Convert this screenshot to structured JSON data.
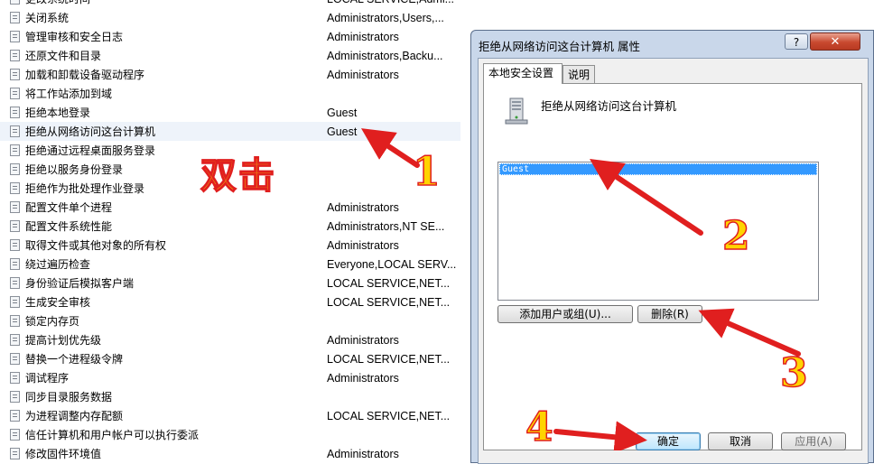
{
  "policies": [
    {
      "name": "更改系统时间",
      "value": "LOCAL SERVICE,Admi..."
    },
    {
      "name": "关闭系统",
      "value": "Administrators,Users,..."
    },
    {
      "name": "管理审核和安全日志",
      "value": "Administrators"
    },
    {
      "name": "还原文件和目录",
      "value": "Administrators,Backu..."
    },
    {
      "name": "加载和卸载设备驱动程序",
      "value": "Administrators"
    },
    {
      "name": "将工作站添加到域",
      "value": ""
    },
    {
      "name": "拒绝本地登录",
      "value": "Guest"
    },
    {
      "name": "拒绝从网络访问这台计算机",
      "value": "Guest",
      "selected": true
    },
    {
      "name": "拒绝通过远程桌面服务登录",
      "value": ""
    },
    {
      "name": "拒绝以服务身份登录",
      "value": ""
    },
    {
      "name": "拒绝作为批处理作业登录",
      "value": ""
    },
    {
      "name": "配置文件单个进程",
      "value": "Administrators"
    },
    {
      "name": "配置文件系统性能",
      "value": "Administrators,NT SE..."
    },
    {
      "name": "取得文件或其他对象的所有权",
      "value": "Administrators"
    },
    {
      "name": "绕过遍历检查",
      "value": "Everyone,LOCAL SERV..."
    },
    {
      "name": "身份验证后模拟客户端",
      "value": "LOCAL SERVICE,NET..."
    },
    {
      "name": "生成安全审核",
      "value": "LOCAL SERVICE,NET..."
    },
    {
      "name": "锁定内存页",
      "value": ""
    },
    {
      "name": "提高计划优先级",
      "value": "Administrators"
    },
    {
      "name": "替换一个进程级令牌",
      "value": "LOCAL SERVICE,NET..."
    },
    {
      "name": "调试程序",
      "value": "Administrators"
    },
    {
      "name": "同步目录服务数据",
      "value": ""
    },
    {
      "name": "为进程调整内存配额",
      "value": "LOCAL SERVICE,NET..."
    },
    {
      "name": "信任计算机和用户帐户可以执行委派",
      "value": ""
    },
    {
      "name": "修改固件环境值",
      "value": "Administrators"
    }
  ],
  "dialog": {
    "title": "拒绝从网络访问这台计算机 属性",
    "help_label": "?",
    "close_label": "✕",
    "tabs": [
      "本地安全设置",
      "说明"
    ],
    "policy_heading": "拒绝从网络访问这台计算机",
    "accounts": [
      "Guest"
    ],
    "add_label": "添加用户或组(U)...",
    "remove_label": "删除(R)",
    "ok_label": "确定",
    "cancel_label": "取消",
    "apply_label": "应用(A)"
  },
  "annotations": {
    "double_click_label": "双击",
    "steps": [
      "1",
      "2",
      "3",
      "4"
    ],
    "arrow_color": "#e01f1f",
    "label_color": "#ffd400"
  }
}
